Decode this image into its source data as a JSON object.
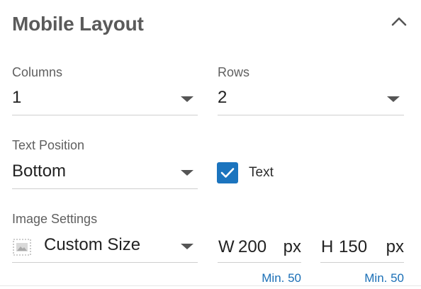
{
  "panel": {
    "title": "Mobile Layout",
    "collapse_icon": "chevron-up-icon"
  },
  "columns": {
    "label": "Columns",
    "value": "1"
  },
  "rows": {
    "label": "Rows",
    "value": "2"
  },
  "text_position": {
    "label": "Text Position",
    "value": "Bottom"
  },
  "text_toggle": {
    "label": "Text",
    "checked": true,
    "icon": "checkmark-icon"
  },
  "image_settings": {
    "label": "Image Settings",
    "icon": "image-placeholder-icon",
    "size_mode": "Custom Size",
    "width": {
      "prefix": "W",
      "value": "200",
      "unit": "px",
      "hint": "Min. 50"
    },
    "height": {
      "prefix": "H",
      "value": "150",
      "unit": "px",
      "hint": "Min. 50"
    }
  },
  "colors": {
    "accent": "#1b74be",
    "hint": "#1a6fb6",
    "title": "#5a5a5a"
  }
}
